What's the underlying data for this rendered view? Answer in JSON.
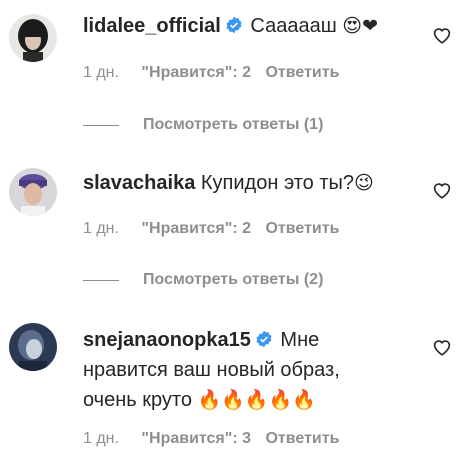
{
  "comments": [
    {
      "username": "lidalee_official",
      "verified": true,
      "text": "Саааааш",
      "emoji": "😍❤",
      "time": "1 дн.",
      "likes": "\"Нравится\": 2",
      "reply": "Ответить",
      "view_replies": "Посмотреть ответы (1)"
    },
    {
      "username": "slavachaika",
      "verified": false,
      "text": "Купидон это ты?",
      "emoji": "😉",
      "time": "1 дн.",
      "likes": "\"Нравится\": 2",
      "reply": "Ответить",
      "view_replies": "Посмотреть ответы (2)"
    },
    {
      "username": "snejanaonopka15",
      "verified": true,
      "text_line1": "Мне",
      "text_line2": "нравится ваш новый образ,",
      "text_line3": "очень круто",
      "emoji": "🔥🔥🔥🔥🔥",
      "time": "1 дн.",
      "likes": "\"Нравится\": 3",
      "reply": "Ответить"
    }
  ],
  "colors": {
    "text": "#262626",
    "secondary": "#8e8e8e",
    "verified_blue": "#3897f0",
    "heart_emoji": "#e0245e"
  },
  "icons": [
    "avatar",
    "verified-badge-icon",
    "heart-outline-icon"
  ]
}
